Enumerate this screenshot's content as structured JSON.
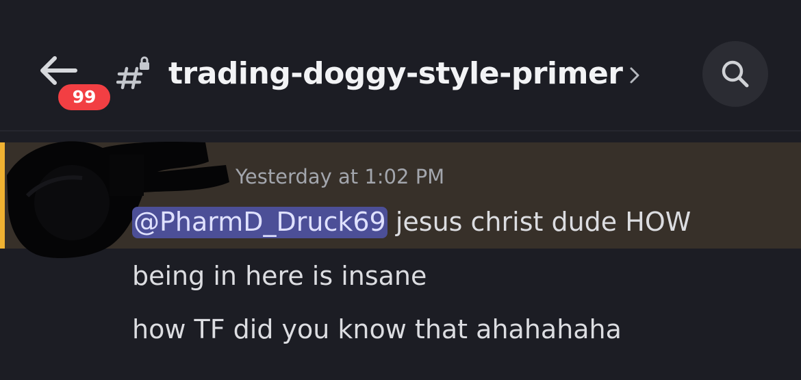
{
  "header": {
    "back_icon": "arrow-left-icon",
    "unread_badge": "99",
    "channel_icon": "locked-hashtag-icon",
    "channel_name": "trading-doggy-style-primer",
    "chevron_icon": "chevron-right-icon",
    "search_icon": "search-icon"
  },
  "message": {
    "timestamp": "Yesterday at 1:02 PM",
    "mention": "@PharmD_Druck69",
    "lines": [
      "jesus christ dude HOW",
      "being in here is insane",
      "how TF did you know that ahahahaha"
    ]
  },
  "colors": {
    "background": "#1c1d24",
    "highlight_row": "#373029",
    "highlight_bar": "#f0b232",
    "badge": "#f23f43",
    "mention_bg": "#4c4f97"
  }
}
